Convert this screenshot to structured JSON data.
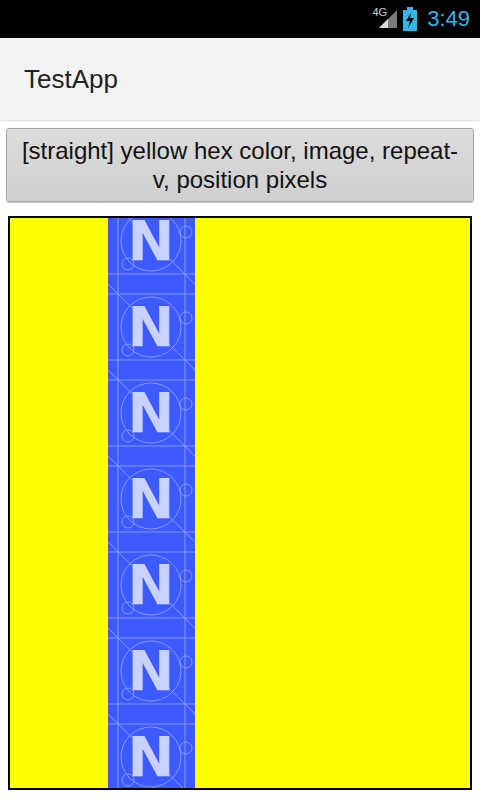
{
  "status_bar": {
    "network": "4G",
    "time": "3:49",
    "battery_charging": true
  },
  "action_bar": {
    "title": "TestApp"
  },
  "button": {
    "label": "[straight] yellow hex color, image, repeat-v, position pixels"
  },
  "panel": {
    "tile_letter": "N"
  }
}
